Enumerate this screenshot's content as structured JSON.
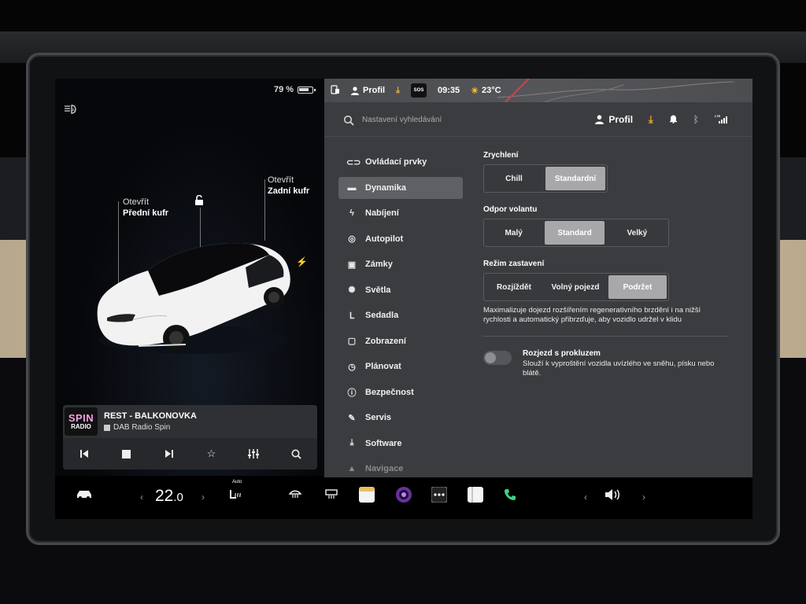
{
  "status": {
    "battery": "79 %",
    "profile": "Profil",
    "time": "09:35",
    "temperature": "23°C",
    "sos": "SOS"
  },
  "car": {
    "front_trunk_line1": "Otevřít",
    "front_trunk_line2": "Přední kufr",
    "rear_trunk_line1": "Otevřít",
    "rear_trunk_line2": "Zadní kufr"
  },
  "media": {
    "logo_top": "SPIN",
    "logo_bottom": "RADIO",
    "title": "REST - BALKONOVKA",
    "source": "DAB Radio Spin"
  },
  "settings": {
    "search_placeholder": "Nastavení vyhledávání",
    "profile": "Profil",
    "menu": [
      {
        "label": "Ovládací prvky",
        "icon": "toggle-icon"
      },
      {
        "label": "Dynamika",
        "icon": "car-icon"
      },
      {
        "label": "Nabíjení",
        "icon": "bolt-icon"
      },
      {
        "label": "Autopilot",
        "icon": "steering-wheel-icon"
      },
      {
        "label": "Zámky",
        "icon": "lock-icon"
      },
      {
        "label": "Světla",
        "icon": "light-icon"
      },
      {
        "label": "Sedadla",
        "icon": "seat-icon"
      },
      {
        "label": "Zobrazení",
        "icon": "display-icon"
      },
      {
        "label": "Plánovat",
        "icon": "clock-icon"
      },
      {
        "label": "Bezpečnost",
        "icon": "info-icon"
      },
      {
        "label": "Servis",
        "icon": "wrench-icon"
      },
      {
        "label": "Software",
        "icon": "download-icon"
      },
      {
        "label": "Navigace",
        "icon": "navigation-icon"
      }
    ],
    "acceleration": {
      "label": "Zrychlení",
      "options": [
        "Chill",
        "Standardní"
      ],
      "selected": "Standardní"
    },
    "steering": {
      "label": "Odpor volantu",
      "options": [
        "Malý",
        "Standard",
        "Velký"
      ],
      "selected": "Standard"
    },
    "stopping": {
      "label": "Režim zastavení",
      "options": [
        "Rozjíždět",
        "Volný pojezd",
        "Podržet"
      ],
      "selected": "Podržet",
      "description": "Maximalizuje dojezd rozšířením regenerativního brzdění i na nižší rychlosti a automatický přibrzďuje, aby vozidlo udržel v klidu"
    },
    "slip_start": {
      "title": "Rozjezd s prokluzem",
      "description": "Slouží k vyproštění vozidla uvízlého ve sněhu, písku nebo blátě.",
      "enabled": false
    }
  },
  "bottom_bar": {
    "temp_whole": "22",
    "temp_decimal": ".0",
    "auto_label": "Auto"
  }
}
